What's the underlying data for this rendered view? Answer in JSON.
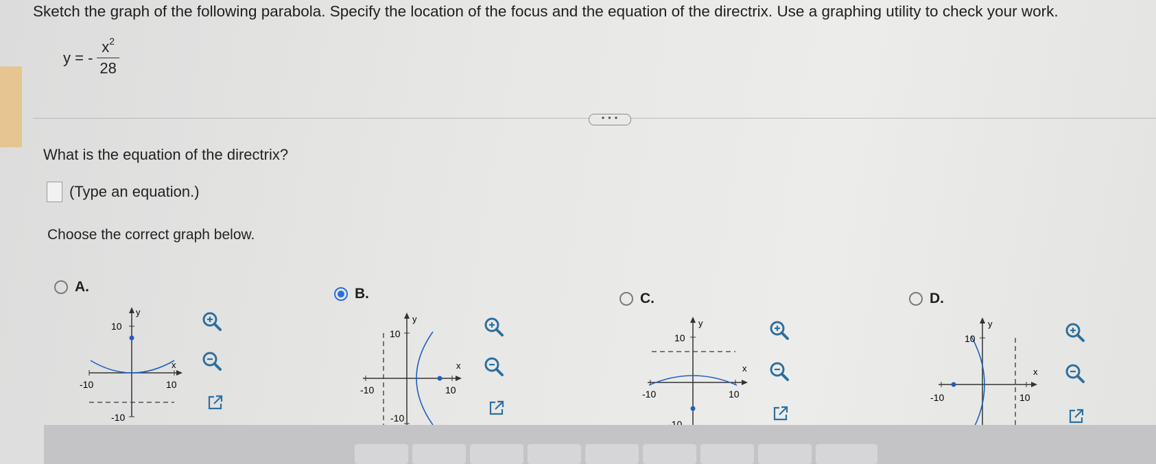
{
  "question_text": "Sketch the graph of the following parabola. Specify the location of the focus and the equation of the directrix. Use a graphing utility to check your work.",
  "equation": {
    "lhs": "y = -",
    "numerator": "x",
    "exponent": "2",
    "denominator": "28"
  },
  "more_button": "• • •",
  "directrix_prompt": "What is the equation of the directrix?",
  "answer_hint": "(Type an equation.)",
  "graph_prompt": "Choose the correct graph below.",
  "options": [
    {
      "letter": "A.",
      "selected": false
    },
    {
      "letter": "B.",
      "selected": true
    },
    {
      "letter": "C.",
      "selected": false
    },
    {
      "letter": "D.",
      "selected": false
    }
  ],
  "axis_labels": {
    "x": "x",
    "y": "y",
    "pos": "10",
    "neg": "-10"
  },
  "icons": {
    "zoom_in": "zoom-in-icon",
    "zoom_out": "zoom-out-icon",
    "popout": "external-link-icon"
  },
  "colors": {
    "curve": "#1f5fbf",
    "accent_strip": "#e8c183",
    "selected_radio": "#2a6fd6"
  }
}
